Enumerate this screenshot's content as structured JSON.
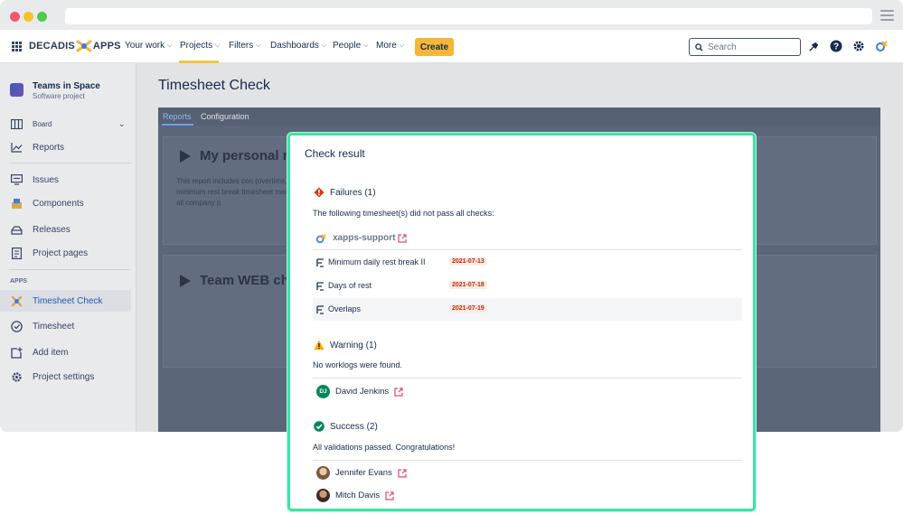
{
  "app": {
    "logo_text_left": "DECADIS",
    "logo_text_right": "APPS"
  },
  "nav": {
    "items": [
      {
        "label": "Your work"
      },
      {
        "label": "Projects"
      },
      {
        "label": "Filters"
      },
      {
        "label": "Dashboards"
      },
      {
        "label": "People"
      },
      {
        "label": "More"
      }
    ],
    "create_label": "Create",
    "search_placeholder": "Search"
  },
  "sidebar": {
    "project_name": "Teams in Space",
    "project_type": "Software project",
    "items": [
      {
        "label": "Board",
        "icon": "board-icon"
      },
      {
        "label": "Reports",
        "icon": "reports-icon"
      },
      {
        "label": "Issues",
        "icon": "issues-icon"
      },
      {
        "label": "Components",
        "icon": "components-icon"
      },
      {
        "label": "Releases",
        "icon": "releases-icon"
      },
      {
        "label": "Project pages",
        "icon": "pages-icon"
      }
    ],
    "apps_heading": "APPS",
    "app_items": [
      {
        "label": "Timesheet Check",
        "icon": "timesheet-check-icon",
        "active": true
      },
      {
        "label": "Timesheet",
        "icon": "timesheet-icon"
      },
      {
        "label": "Add item",
        "icon": "add-item-icon"
      },
      {
        "label": "Project settings",
        "icon": "settings-icon"
      }
    ]
  },
  "main": {
    "title": "Timesheet Check",
    "tabs": [
      {
        "label": "Reports",
        "active": true
      },
      {
        "label": "Configuration"
      }
    ],
    "reports": [
      {
        "title": "My personal rep",
        "desc": "This report includes con (overtime, minimum rest break timesheet meets all company p"
      },
      {
        "title": "Team WEB che",
        "desc": ""
      }
    ]
  },
  "modal": {
    "title": "Check result",
    "failures": {
      "title": "Failures (1)",
      "desc": "The following timesheet(s) did not pass all checks:",
      "user": "xapps-support",
      "rows": [
        {
          "name": "Minimum daily rest break II",
          "date": "2021-07-13"
        },
        {
          "name": "Days of rest",
          "date": "2021-07-18"
        },
        {
          "name": "Overlaps",
          "date": "2021-07-19"
        }
      ]
    },
    "warning": {
      "title": "Warning (1)",
      "desc": "No worklogs were found.",
      "user": "David Jenkins",
      "user_initials": "DJ"
    },
    "success": {
      "title": "Success (2)",
      "desc": "All validations passed. Congratulations!",
      "users": [
        {
          "name": "Jennifer Evans"
        },
        {
          "name": "Mitch Davis"
        }
      ]
    }
  },
  "colors": {
    "accent": "#3ee3a6",
    "create": "#f6b637",
    "failure": "#de350b",
    "warning": "#ffab00",
    "success": "#00875a",
    "link_external": "#e5486c"
  }
}
